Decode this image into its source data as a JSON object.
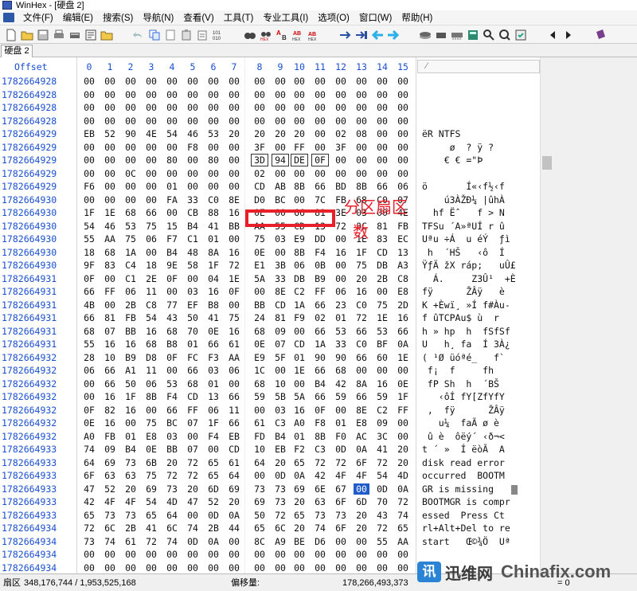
{
  "window": {
    "title": "WinHex - [硬盘 2]"
  },
  "menu": [
    "文件(F)",
    "编辑(E)",
    "搜索(S)",
    "导航(N)",
    "查看(V)",
    "工具(T)",
    "专业工具(I)",
    "选项(O)",
    "窗口(W)",
    "帮助(H)"
  ],
  "tab": {
    "label": "硬盘 2"
  },
  "editor": {
    "offset_header": "Offset",
    "columns": [
      "0",
      "1",
      "2",
      "3",
      "4",
      "5",
      "6",
      "7",
      "8",
      "9",
      "10",
      "11",
      "12",
      "13",
      "14",
      "15"
    ],
    "rows": [
      {
        "offset": "1782664928",
        "bytes": [
          "00",
          "00",
          "00",
          "00",
          "00",
          "00",
          "00",
          "00",
          "00",
          "00",
          "00",
          "00",
          "00",
          "00",
          "00",
          "00"
        ],
        "ascii": ""
      },
      {
        "offset": "1782664928",
        "bytes": [
          "00",
          "00",
          "00",
          "00",
          "00",
          "00",
          "00",
          "00",
          "00",
          "00",
          "00",
          "00",
          "00",
          "00",
          "00",
          "00"
        ],
        "ascii": ""
      },
      {
        "offset": "1782664928",
        "bytes": [
          "00",
          "00",
          "00",
          "00",
          "00",
          "00",
          "00",
          "00",
          "00",
          "00",
          "00",
          "00",
          "00",
          "00",
          "00",
          "00"
        ],
        "ascii": ""
      },
      {
        "offset": "1782664928",
        "bytes": [
          "00",
          "00",
          "00",
          "00",
          "00",
          "00",
          "00",
          "00",
          "00",
          "00",
          "00",
          "00",
          "00",
          "00",
          "00",
          "00"
        ],
        "ascii": ""
      },
      {
        "offset": "1782664929",
        "bytes": [
          "EB",
          "52",
          "90",
          "4E",
          "54",
          "46",
          "53",
          "20",
          "20",
          "20",
          "20",
          "00",
          "02",
          "08",
          "00",
          "00"
        ],
        "ascii": "ëR NTFS"
      },
      {
        "offset": "1782664929",
        "bytes": [
          "00",
          "00",
          "00",
          "00",
          "00",
          "F8",
          "00",
          "00",
          "3F",
          "00",
          "FF",
          "00",
          "3F",
          "00",
          "00",
          "00"
        ],
        "ascii": "     ø  ? ÿ ?"
      },
      {
        "offset": "1782664929",
        "bytes": [
          "00",
          "00",
          "00",
          "00",
          "80",
          "00",
          "80",
          "00",
          "3D",
          "94",
          "DE",
          "0F",
          "00",
          "00",
          "00",
          "00"
        ],
        "ascii": "    € € =\"Þ"
      },
      {
        "offset": "1782664929",
        "bytes": [
          "00",
          "00",
          "0C",
          "00",
          "00",
          "00",
          "00",
          "00",
          "02",
          "00",
          "00",
          "00",
          "00",
          "00",
          "00",
          "00"
        ],
        "ascii": ""
      },
      {
        "offset": "1782664929",
        "bytes": [
          "F6",
          "00",
          "00",
          "00",
          "01",
          "00",
          "00",
          "00",
          "CD",
          "AB",
          "8B",
          "66",
          "BD",
          "8B",
          "66",
          "06"
        ],
        "ascii": "ö       Í«‹f½‹f"
      },
      {
        "offset": "1782664930",
        "bytes": [
          "00",
          "00",
          "00",
          "00",
          "FA",
          "33",
          "C0",
          "8E",
          "D0",
          "BC",
          "00",
          "7C",
          "FB",
          "68",
          "C0",
          "07"
        ],
        "ascii": "    ú3ÀŽÐ¼ |ûhÀ"
      },
      {
        "offset": "1782664930",
        "bytes": [
          "1F",
          "1E",
          "68",
          "66",
          "00",
          "CB",
          "88",
          "16",
          "0E",
          "00",
          "66",
          "81",
          "3E",
          "03",
          "00",
          "4E"
        ],
        "ascii": "  hf Ëˆ   f > N"
      },
      {
        "offset": "1782664930",
        "bytes": [
          "54",
          "46",
          "53",
          "75",
          "15",
          "B4",
          "41",
          "BB",
          "AA",
          "55",
          "CD",
          "13",
          "72",
          "0C",
          "81",
          "FB"
        ],
        "ascii": "TFSu ´A»ªUÍ r û"
      },
      {
        "offset": "1782664930",
        "bytes": [
          "55",
          "AA",
          "75",
          "06",
          "F7",
          "C1",
          "01",
          "00",
          "75",
          "03",
          "E9",
          "DD",
          "00",
          "1E",
          "83",
          "EC"
        ],
        "ascii": "Uªu ÷Á  u éÝ  ƒì"
      },
      {
        "offset": "1782664930",
        "bytes": [
          "18",
          "68",
          "1A",
          "00",
          "B4",
          "48",
          "8A",
          "16",
          "0E",
          "00",
          "8B",
          "F4",
          "16",
          "1F",
          "CD",
          "13"
        ],
        "ascii": " h  ´HŠ   ‹ô  Í"
      },
      {
        "offset": "1782664930",
        "bytes": [
          "9F",
          "83",
          "C4",
          "18",
          "9E",
          "58",
          "1F",
          "72",
          "E1",
          "3B",
          "06",
          "0B",
          "00",
          "75",
          "DB",
          "A3"
        ],
        "ascii": "ŸƒÄ žX ráp;   uÛ£"
      },
      {
        "offset": "1782664931",
        "bytes": [
          "0F",
          "00",
          "C1",
          "2E",
          "0F",
          "00",
          "04",
          "1E",
          "5A",
          "33",
          "DB",
          "B9",
          "00",
          "20",
          "2B",
          "C8"
        ],
        "ascii": "  Á.     Z3Û¹  +È"
      },
      {
        "offset": "1782664931",
        "bytes": [
          "66",
          "FF",
          "06",
          "11",
          "00",
          "03",
          "16",
          "0F",
          "00",
          "8E",
          "C2",
          "FF",
          "06",
          "16",
          "00",
          "E8"
        ],
        "ascii": "fÿ      ŽÂÿ   è"
      },
      {
        "offset": "1782664931",
        "bytes": [
          "4B",
          "00",
          "2B",
          "C8",
          "77",
          "EF",
          "B8",
          "00",
          "BB",
          "CD",
          "1A",
          "66",
          "23",
          "C0",
          "75",
          "2D"
        ],
        "ascii": "K +Èwï¸ »Í f#Àu-"
      },
      {
        "offset": "1782664931",
        "bytes": [
          "66",
          "81",
          "FB",
          "54",
          "43",
          "50",
          "41",
          "75",
          "24",
          "81",
          "F9",
          "02",
          "01",
          "72",
          "1E",
          "16"
        ],
        "ascii": "f ûTCPAu$ ù  r"
      },
      {
        "offset": "1782664931",
        "bytes": [
          "68",
          "07",
          "BB",
          "16",
          "68",
          "70",
          "0E",
          "16",
          "68",
          "09",
          "00",
          "66",
          "53",
          "66",
          "53",
          "66"
        ],
        "ascii": "h » hp  h  fSfSf"
      },
      {
        "offset": "1782664931",
        "bytes": [
          "55",
          "16",
          "16",
          "68",
          "B8",
          "01",
          "66",
          "61",
          "0E",
          "07",
          "CD",
          "1A",
          "33",
          "C0",
          "BF",
          "0A"
        ],
        "ascii": "U   h¸ fa  Í 3À¿"
      },
      {
        "offset": "1782664932",
        "bytes": [
          "28",
          "10",
          "B9",
          "D8",
          "0F",
          "FC",
          "F3",
          "AA",
          "E9",
          "5F",
          "01",
          "90",
          "90",
          "66",
          "60",
          "1E"
        ],
        "ascii": "( ¹Ø üóªé_   f`"
      },
      {
        "offset": "1782664932",
        "bytes": [
          "06",
          "66",
          "A1",
          "11",
          "00",
          "66",
          "03",
          "06",
          "1C",
          "00",
          "1E",
          "66",
          "68",
          "00",
          "00",
          "00"
        ],
        "ascii": " f¡  f     fh"
      },
      {
        "offset": "1782664932",
        "bytes": [
          "00",
          "66",
          "50",
          "06",
          "53",
          "68",
          "01",
          "00",
          "68",
          "10",
          "00",
          "B4",
          "42",
          "8A",
          "16",
          "0E"
        ],
        "ascii": " fP Sh  h  ´BŠ"
      },
      {
        "offset": "1782664932",
        "bytes": [
          "00",
          "16",
          "1F",
          "8B",
          "F4",
          "CD",
          "13",
          "66",
          "59",
          "5B",
          "5A",
          "66",
          "59",
          "66",
          "59",
          "1F"
        ],
        "ascii": "   ‹ôÍ fY[ZfYfY"
      },
      {
        "offset": "1782664932",
        "bytes": [
          "0F",
          "82",
          "16",
          "00",
          "66",
          "FF",
          "06",
          "11",
          "00",
          "03",
          "16",
          "0F",
          "00",
          "8E",
          "C2",
          "FF"
        ],
        "ascii": " ‚  fÿ      ŽÂÿ"
      },
      {
        "offset": "1782664932",
        "bytes": [
          "0E",
          "16",
          "00",
          "75",
          "BC",
          "07",
          "1F",
          "66",
          "61",
          "C3",
          "A0",
          "F8",
          "01",
          "E8",
          "09",
          "00"
        ],
        "ascii": "   u¼  faÃ ø è"
      },
      {
        "offset": "1782664932",
        "bytes": [
          "A0",
          "FB",
          "01",
          "E8",
          "03",
          "00",
          "F4",
          "EB",
          "FD",
          "B4",
          "01",
          "8B",
          "F0",
          "AC",
          "3C",
          "00"
        ],
        "ascii": " û è  ôëý´ ‹ð¬<"
      },
      {
        "offset": "1782664933",
        "bytes": [
          "74",
          "09",
          "B4",
          "0E",
          "BB",
          "07",
          "00",
          "CD",
          "10",
          "EB",
          "F2",
          "C3",
          "0D",
          "0A",
          "41",
          "20"
        ],
        "ascii": "t ´ »  Í ëòÃ  A"
      },
      {
        "offset": "1782664933",
        "bytes": [
          "64",
          "69",
          "73",
          "6B",
          "20",
          "72",
          "65",
          "61",
          "64",
          "20",
          "65",
          "72",
          "72",
          "6F",
          "72",
          "20"
        ],
        "ascii": "disk read error"
      },
      {
        "offset": "1782664933",
        "bytes": [
          "6F",
          "63",
          "63",
          "75",
          "72",
          "72",
          "65",
          "64",
          "00",
          "0D",
          "0A",
          "42",
          "4F",
          "4F",
          "54",
          "4D"
        ],
        "ascii": "occurred  BOOTM"
      },
      {
        "offset": "1782664933",
        "bytes": [
          "47",
          "52",
          "20",
          "69",
          "73",
          "20",
          "6D",
          "69",
          "73",
          "73",
          "69",
          "6E",
          "67",
          "00",
          "0D",
          "0A"
        ],
        "ascii": "GR is missing"
      },
      {
        "offset": "1782664933",
        "bytes": [
          "42",
          "4F",
          "4F",
          "54",
          "4D",
          "47",
          "52",
          "20",
          "69",
          "73",
          "20",
          "63",
          "6F",
          "6D",
          "70",
          "72"
        ],
        "ascii": "BOOTMGR is compr"
      },
      {
        "offset": "1782664933",
        "bytes": [
          "65",
          "73",
          "73",
          "65",
          "64",
          "00",
          "0D",
          "0A",
          "50",
          "72",
          "65",
          "73",
          "73",
          "20",
          "43",
          "74"
        ],
        "ascii": "essed  Press Ct"
      },
      {
        "offset": "1782664934",
        "bytes": [
          "72",
          "6C",
          "2B",
          "41",
          "6C",
          "74",
          "2B",
          "44",
          "65",
          "6C",
          "20",
          "74",
          "6F",
          "20",
          "72",
          "65"
        ],
        "ascii": "rl+Alt+Del to re"
      },
      {
        "offset": "1782664934",
        "bytes": [
          "73",
          "74",
          "61",
          "72",
          "74",
          "0D",
          "0A",
          "00",
          "8C",
          "A9",
          "BE",
          "D6",
          "00",
          "00",
          "55",
          "AA"
        ],
        "ascii": "start   Œ©¾Ö  Uª"
      },
      {
        "offset": "1782664934",
        "bytes": [
          "00",
          "00",
          "00",
          "00",
          "00",
          "00",
          "00",
          "00",
          "00",
          "00",
          "00",
          "00",
          "00",
          "00",
          "00",
          "00"
        ],
        "ascii": ""
      },
      {
        "offset": "1782664934",
        "bytes": [
          "00",
          "00",
          "00",
          "00",
          "00",
          "00",
          "00",
          "00",
          "00",
          "00",
          "00",
          "00",
          "00",
          "00",
          "00",
          "00"
        ],
        "ascii": ""
      }
    ]
  },
  "annotation": {
    "line1": "分区扇区",
    "line2": "数"
  },
  "status": {
    "sector_label": "扇区",
    "sector_value": "348,176,744 / 1,953,525,168",
    "offset_label": "偏移量:",
    "offset_value": "178,266,493,373",
    "right_value": "= 0"
  },
  "watermark": {
    "logo": "讯",
    "cn": "迅维网",
    "en": "Chinafix.com"
  }
}
